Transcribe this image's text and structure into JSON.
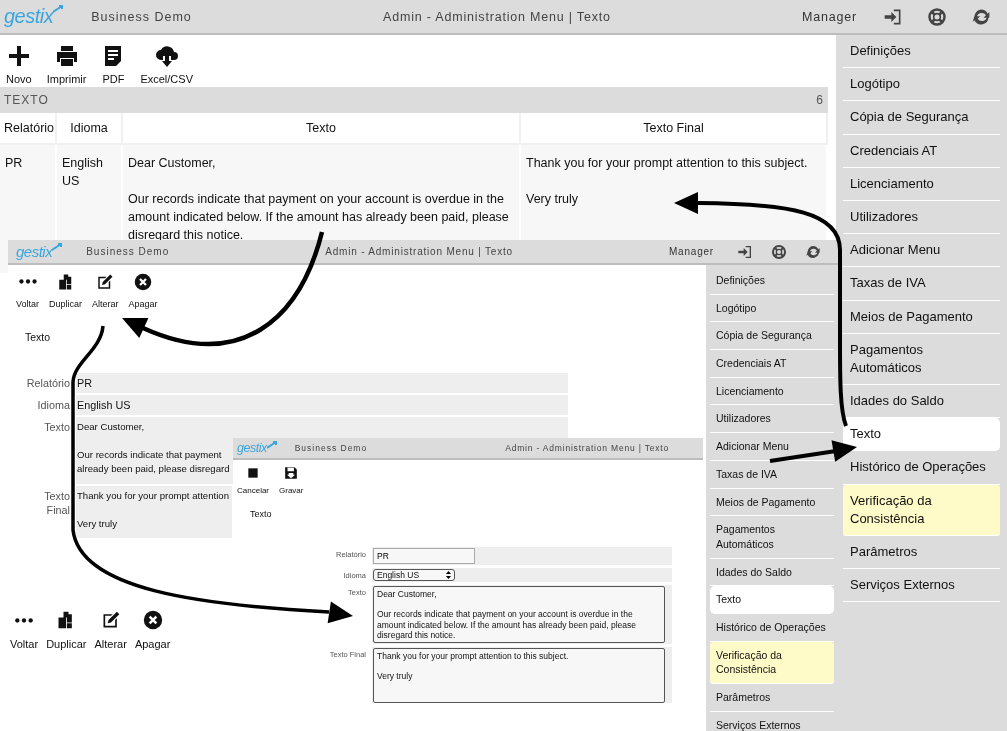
{
  "list_screen": {
    "header": {
      "logo": "gestix",
      "company": "Business Demo",
      "title": "Admin - Administration Menu | Texto",
      "user": "Manager"
    },
    "toolbar": [
      {
        "label": "Novo"
      },
      {
        "label": "Imprimir"
      },
      {
        "label": "PDF"
      },
      {
        "label": "Excel/CSV"
      }
    ],
    "table": {
      "title": "TEXTO",
      "count": "6",
      "columns": [
        "Relatório",
        "Idioma",
        "Texto",
        "Texto Final"
      ],
      "rows": [
        {
          "cells": [
            "PR",
            "English US",
            "Dear Customer,\n\nOur records indicate that payment on your account is overdue in the amount indicated below. If the amount has already been paid, please disregard this notice.",
            "Thank you for your prompt attention to this subject.\n\nVery truly"
          ]
        }
      ]
    },
    "sidebar": [
      {
        "label": "Definições",
        "selected": false,
        "highlighted": false
      },
      {
        "label": "Logótipo",
        "selected": false,
        "highlighted": false
      },
      {
        "label": "Cópia de Segurança",
        "selected": false,
        "highlighted": false
      },
      {
        "label": "Credenciais AT",
        "selected": false,
        "highlighted": false
      },
      {
        "label": "Licenciamento",
        "selected": false,
        "highlighted": false
      },
      {
        "label": "Utilizadores",
        "selected": false,
        "highlighted": false
      },
      {
        "label": "Adicionar Menu",
        "selected": false,
        "highlighted": false
      },
      {
        "label": "Taxas de IVA",
        "selected": false,
        "highlighted": false
      },
      {
        "label": "Meios de Pagamento",
        "selected": false,
        "highlighted": false
      },
      {
        "label": "Pagamentos Automáticos",
        "selected": false,
        "highlighted": false
      },
      {
        "label": "Idades do Saldo",
        "selected": false,
        "highlighted": false
      },
      {
        "label": "Texto",
        "selected": true,
        "highlighted": false
      },
      {
        "label": "Histórico de Operações",
        "selected": false,
        "highlighted": false
      },
      {
        "label": "Verificação da Consistência",
        "selected": false,
        "highlighted": true
      },
      {
        "label": "Parâmetros",
        "selected": false,
        "highlighted": false
      },
      {
        "label": "Serviços Externos",
        "selected": false,
        "highlighted": false
      }
    ]
  },
  "detail_screen": {
    "header": {
      "logo": "gestix",
      "company": "Business Demo",
      "title": "Admin - Administration Menu | Texto",
      "user": "Manager"
    },
    "toolbar": [
      {
        "label": "Voltar"
      },
      {
        "label": "Duplicar"
      },
      {
        "label": "Alterar"
      },
      {
        "label": "Apagar"
      }
    ],
    "heading": "Texto",
    "fields": [
      {
        "label": "Relatório",
        "value": "PR"
      },
      {
        "label": "Idioma",
        "value": "English US"
      },
      {
        "label": "Texto",
        "value": "Dear Customer,\n\nOur records indicate that payment\nalready been paid, please disregard"
      },
      {
        "label": "Texto Final",
        "value": "Thank you for your prompt attention\n\nVery truly"
      }
    ],
    "bottom_toolbar": [
      {
        "label": "Voltar"
      },
      {
        "label": "Duplicar"
      },
      {
        "label": "Alterar"
      },
      {
        "label": "Apagar"
      }
    ],
    "sidebar": [
      {
        "label": "Definições",
        "selected": false,
        "highlighted": false
      },
      {
        "label": "Logótipo",
        "selected": false,
        "highlighted": false
      },
      {
        "label": "Cópia de Segurança",
        "selected": false,
        "highlighted": false
      },
      {
        "label": "Credenciais AT",
        "selected": false,
        "highlighted": false
      },
      {
        "label": "Licenciamento",
        "selected": false,
        "highlighted": false
      },
      {
        "label": "Utilizadores",
        "selected": false,
        "highlighted": false
      },
      {
        "label": "Adicionar Menu",
        "selected": false,
        "highlighted": false
      },
      {
        "label": "Taxas de IVA",
        "selected": false,
        "highlighted": false
      },
      {
        "label": "Meios de Pagamento",
        "selected": false,
        "highlighted": false
      },
      {
        "label": "Pagamentos Automáticos",
        "selected": false,
        "highlighted": false
      },
      {
        "label": "Idades do Saldo",
        "selected": false,
        "highlighted": false
      },
      {
        "label": "Texto",
        "selected": true,
        "highlighted": false
      },
      {
        "label": "Histórico de Operações",
        "selected": false,
        "highlighted": false
      },
      {
        "label": "Verificação da Consistência",
        "selected": false,
        "highlighted": true
      },
      {
        "label": "Parâmetros",
        "selected": false,
        "highlighted": false
      },
      {
        "label": "Serviços Externos",
        "selected": false,
        "highlighted": false
      }
    ]
  },
  "edit_screen": {
    "header": {
      "logo": "gestix",
      "company": "Business Demo",
      "title": "Admin - Administration Menu | Texto"
    },
    "toolbar": [
      {
        "label": "Cancelar"
      },
      {
        "label": "Gravar"
      }
    ],
    "heading": "Texto",
    "fields": [
      {
        "kind": "input",
        "label": "Relatório",
        "value": "PR"
      },
      {
        "kind": "select",
        "label": "Idioma",
        "value": "English US"
      },
      {
        "kind": "textarea",
        "label": "Texto",
        "value": "Dear Customer,\n\nOur records indicate that payment on your account is overdue in the amount indicated below. If the amount has already been paid, please disregard this notice."
      },
      {
        "kind": "textarea",
        "label": "Texto Final",
        "value": "Thank you for your prompt attention to this subject.\n\nVery truly"
      }
    ]
  }
}
